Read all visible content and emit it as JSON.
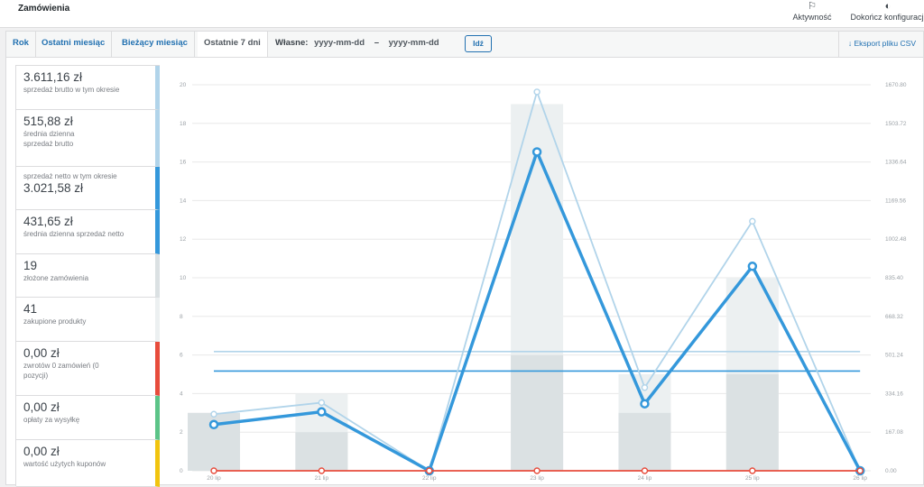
{
  "header": {
    "title": "Zamówienia",
    "activity_label": "Aktywność",
    "finish_setup_label": "Dokończ konfiguracji",
    "activity_icon": "flag-icon",
    "finish_setup_icon": "progress-circle-icon"
  },
  "tabs": [
    {
      "label": "Rok",
      "active": false
    },
    {
      "label": "Ostatni miesiąc",
      "active": false
    },
    {
      "label": "Bieżący miesiąc",
      "active": false
    },
    {
      "label": "Ostatnie 7 dni",
      "active": true
    }
  ],
  "custom_range": {
    "label": "Własne:",
    "start_placeholder": "yyyy-mm-dd",
    "separator": "–",
    "end_placeholder": "yyyy-mm-dd",
    "go_label": "Idź"
  },
  "export": {
    "label": "Eksport pliku CSV",
    "icon": "download-arrow-icon"
  },
  "legend": [
    {
      "amount": "3.611,16 zł",
      "label": "sprzedaż brutto w tym okresie",
      "color": "#b1d4ea",
      "amount_first": true
    },
    {
      "amount": "515,88 zł",
      "label": "średnia dzienna sprzedaż brutto",
      "color": "#b1d4ea",
      "amount_first": true
    },
    {
      "amount": "3.021,58 zł",
      "label": "sprzedaż netto w tym okresie",
      "color": "#3498db",
      "amount_first": false
    },
    {
      "amount": "431,65 zł",
      "label": "średnia dzienna sprzedaż netto",
      "color": "#3498db",
      "amount_first": true
    },
    {
      "amount": "19",
      "label": "złożone zamówienia",
      "color": "#dbe1e3",
      "amount_first": true
    },
    {
      "amount": "41",
      "label": "zakupione produkty",
      "color": "#ecf0f1",
      "amount_first": true
    },
    {
      "amount": "0,00 zł",
      "label": "zwrotów 0 zamówień (0 pozycji)",
      "color": "#e74c3c",
      "amount_first": true
    },
    {
      "amount": "0,00 zł",
      "label": "opłaty za wysyłkę",
      "color": "#5cc488",
      "amount_first": true
    },
    {
      "amount": "0,00 zł",
      "label": "wartość użytych kuponów",
      "color": "#f1c40f",
      "amount_first": true
    }
  ],
  "chart_data": {
    "type": "bar",
    "categories": [
      "20 lip",
      "21 lip",
      "22 lip",
      "23 lip",
      "24 lip",
      "25 lip",
      "26 lip"
    ],
    "y_left_ticks": [
      "0",
      "2",
      "4",
      "6",
      "8",
      "10",
      "12",
      "14",
      "16",
      "18",
      "20"
    ],
    "y_right_ticks": [
      "0.00",
      "167.08",
      "334.16",
      "501.24",
      "668.32",
      "835.40",
      "1002.48",
      "1169.56",
      "1336.64",
      "1503.72",
      "1670.80"
    ],
    "ylim_left": [
      0,
      20
    ],
    "ylim_right": [
      0,
      1670.8
    ],
    "grid": true,
    "series": [
      {
        "name": "zakupione produkty",
        "axis": "left",
        "kind": "bar",
        "color": "#ecf0f1",
        "values": [
          3,
          4,
          0,
          19,
          5,
          10,
          0
        ]
      },
      {
        "name": "złożone zamówienia",
        "axis": "left",
        "kind": "bar",
        "color": "#dbe1e3",
        "values": [
          3,
          2,
          0,
          6,
          3,
          5,
          0
        ]
      },
      {
        "name": "sprzedaż brutto w tym okresie",
        "axis": "right",
        "kind": "line",
        "color": "#b1d4ea",
        "values": [
          245,
          295,
          0,
          1640,
          360,
          1080,
          0
        ]
      },
      {
        "name": "sprzedaż netto w tym okresie",
        "axis": "right",
        "kind": "line",
        "color": "#3498db",
        "values": [
          200,
          255,
          0,
          1380,
          290,
          885,
          0
        ]
      },
      {
        "name": "średnia dzienna sprzedaż brutto",
        "axis": "right",
        "kind": "avg",
        "color": "#b1d4ea",
        "values": [
          515.88,
          515.88,
          515.88,
          515.88,
          515.88,
          515.88,
          515.88
        ]
      },
      {
        "name": "średnia dzienna sprzedaż netto",
        "axis": "right",
        "kind": "avg",
        "color": "#3498db",
        "values": [
          431.65,
          431.65,
          431.65,
          431.65,
          431.65,
          431.65,
          431.65
        ]
      },
      {
        "name": "zwrotów",
        "axis": "right",
        "kind": "line",
        "color": "#e74c3c",
        "values": [
          0,
          0,
          0,
          0,
          0,
          0,
          0
        ]
      }
    ]
  }
}
